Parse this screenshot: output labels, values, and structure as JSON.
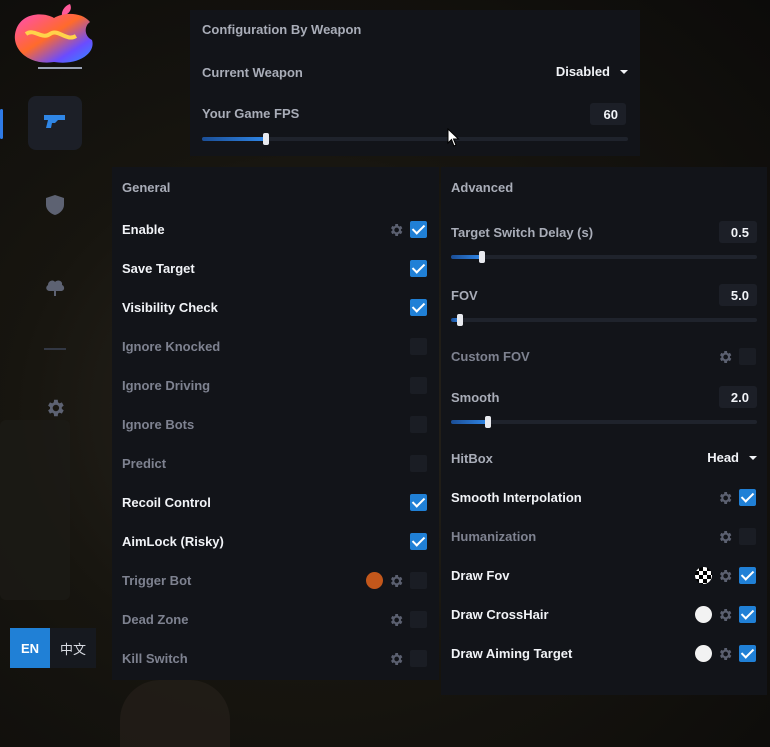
{
  "colors": {
    "accent": "#2080d6",
    "panel": "#121419",
    "muted_text": "#7e8290"
  },
  "sidebar": {
    "items": [
      {
        "icon": "gun-icon",
        "active": true
      },
      {
        "icon": "shield-icon",
        "active": false
      },
      {
        "icon": "cloud-icon",
        "active": false
      },
      {
        "icon": "gear-icon",
        "active": false
      }
    ],
    "languages": [
      "EN",
      "中文"
    ],
    "selected_language": "EN"
  },
  "weapon_config": {
    "title": "Configuration By Weapon",
    "current_weapon_label": "Current Weapon",
    "current_weapon_value": "Disabled",
    "fps_label": "Your Game FPS",
    "fps_value": "60",
    "fps_fraction": 0.15
  },
  "general": {
    "title": "General",
    "rows": [
      {
        "label": "Enable",
        "checked": true,
        "gear": true,
        "dot": null
      },
      {
        "label": "Save Target",
        "checked": true,
        "gear": false,
        "dot": null
      },
      {
        "label": "Visibility Check",
        "checked": true,
        "gear": false,
        "dot": null
      },
      {
        "label": "Ignore Knocked",
        "checked": false,
        "gear": false,
        "dot": null
      },
      {
        "label": "Ignore Driving",
        "checked": false,
        "gear": false,
        "dot": null
      },
      {
        "label": "Ignore Bots",
        "checked": false,
        "gear": false,
        "dot": null
      },
      {
        "label": "Predict",
        "checked": false,
        "gear": false,
        "dot": null
      },
      {
        "label": "Recoil Control",
        "checked": true,
        "gear": false,
        "dot": null
      },
      {
        "label": "AimLock (Risky)",
        "checked": true,
        "gear": false,
        "dot": null
      },
      {
        "label": "Trigger Bot",
        "checked": false,
        "gear": true,
        "dot": "#c2571b"
      },
      {
        "label": "Dead Zone",
        "checked": false,
        "gear": true,
        "dot": null
      },
      {
        "label": "Kill Switch",
        "checked": false,
        "gear": true,
        "dot": null
      }
    ]
  },
  "advanced": {
    "title": "Advanced",
    "target_switch_delay": {
      "label": "Target Switch Delay (s)",
      "value": "0.5",
      "fraction": 0.1
    },
    "fov": {
      "label": "FOV",
      "value": "5.0",
      "fraction": 0.03
    },
    "custom_fov": {
      "label": "Custom FOV",
      "checked": false,
      "gear": true
    },
    "smooth": {
      "label": "Smooth",
      "value": "2.0",
      "fraction": 0.12
    },
    "hitbox": {
      "label": "HitBox",
      "value": "Head"
    },
    "rows": [
      {
        "label": "Smooth Interpolation",
        "checked": true,
        "gear": true,
        "dot": null
      },
      {
        "label": "Humanization",
        "checked": false,
        "gear": true,
        "dot": null
      },
      {
        "label": "Draw Fov",
        "checked": true,
        "gear": true,
        "dot": "checker"
      },
      {
        "label": "Draw CrossHair",
        "checked": true,
        "gear": true,
        "dot": "#f2f2f2"
      },
      {
        "label": "Draw Aiming Target",
        "checked": true,
        "gear": true,
        "dot": "#f2f2f2"
      }
    ]
  }
}
